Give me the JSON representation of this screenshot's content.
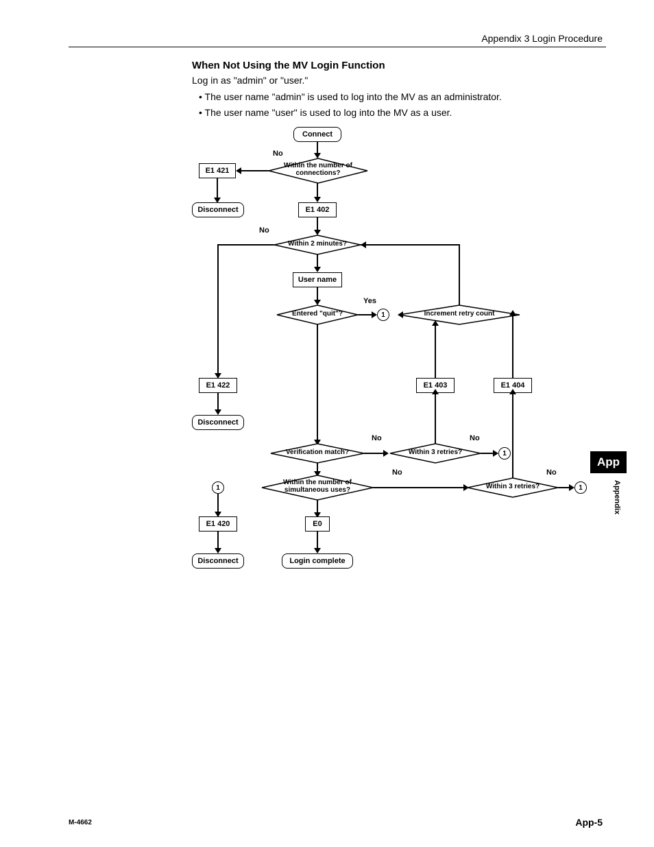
{
  "header": "Appendix 3  Login Procedure",
  "section_title": "When Not Using the MV Login Function",
  "intro": "Log in as \"admin\" or \"user.\"",
  "bullets": [
    "The user name \"admin\" is used to log into the MV as an administrator.",
    "The user name \"user\" is used to log into the MV as a user."
  ],
  "flow": {
    "connect": "Connect",
    "within_conn": "Within the number of connections?",
    "e1_421": "E1 421",
    "disconnect": "Disconnect",
    "e1_402": "E1 402",
    "within_2min": "Within 2 minutes?",
    "user_name": "User name",
    "entered_quit": "Entered \"quit\"?",
    "increment": "Increment retry count",
    "e1_422": "E1 422",
    "e1_403": "E1 403",
    "e1_404": "E1 404",
    "verification": "Verification match?",
    "within_3": "Within 3 retries?",
    "within_sim": "Within the number of simultaneous uses?",
    "e1_420": "E1 420",
    "e0": "E0",
    "login_complete": "Login complete",
    "no": "No",
    "yes": "Yes",
    "one": "1"
  },
  "side_tab": "App",
  "side_label": "Appendix",
  "footer_left": "M-4662",
  "footer_right": "App-5"
}
